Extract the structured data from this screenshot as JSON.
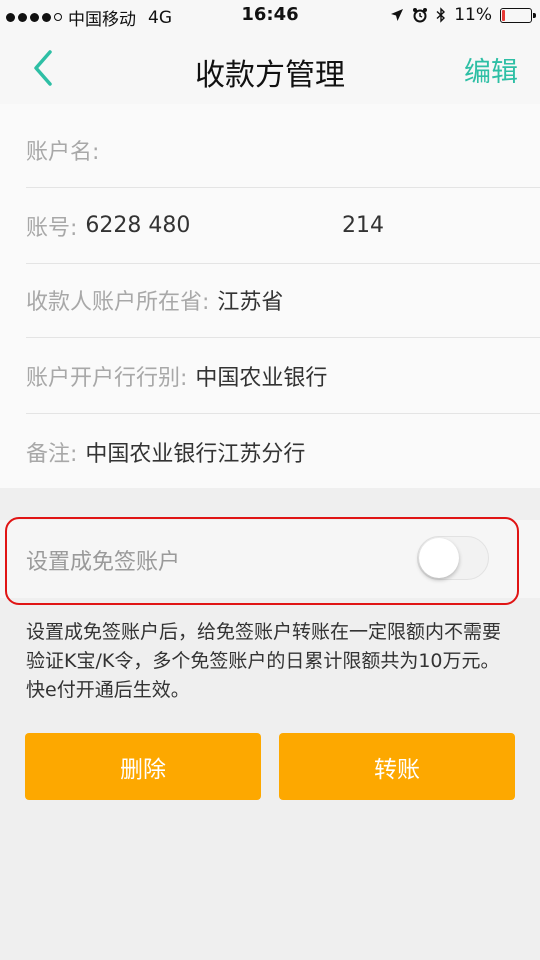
{
  "status_bar": {
    "carrier": "中国移动",
    "network": "4G",
    "time": "16:46",
    "battery": "11%",
    "battery_level": 0.11,
    "icons": [
      "signal-dots-icon",
      "location-arrow-icon",
      "alarm-icon",
      "bluetooth-icon",
      "battery-icon"
    ]
  },
  "nav": {
    "title": "收款方管理",
    "edit_label": "编辑",
    "back_icon": "chevron-left-icon",
    "accent_color": "#2ebfa5"
  },
  "fields": {
    "account_name": {
      "label": "账户名:",
      "value": ""
    },
    "account_number": {
      "label": "账号:",
      "value": "6228 480",
      "value_tail": "214"
    },
    "province": {
      "label": "收款人账户所在省:",
      "value": "江苏省"
    },
    "bank": {
      "label": "账户开户行行别:",
      "value": "中国农业银行"
    },
    "note": {
      "label": "备注:",
      "value": "中国农业银行江苏分行"
    }
  },
  "exempt_toggle": {
    "label": "设置成免签账户",
    "on": false,
    "highlight_color": "#e01414"
  },
  "notice": {
    "text": "设置成免签账户后，给免签账户转账在一定限额内不需要验证K宝/K令，多个免签账户的日累计限额共为10万元。快e付开通后生效。"
  },
  "actions": {
    "delete_label": "删除",
    "transfer_label": "转账",
    "button_color": "#fda800"
  }
}
